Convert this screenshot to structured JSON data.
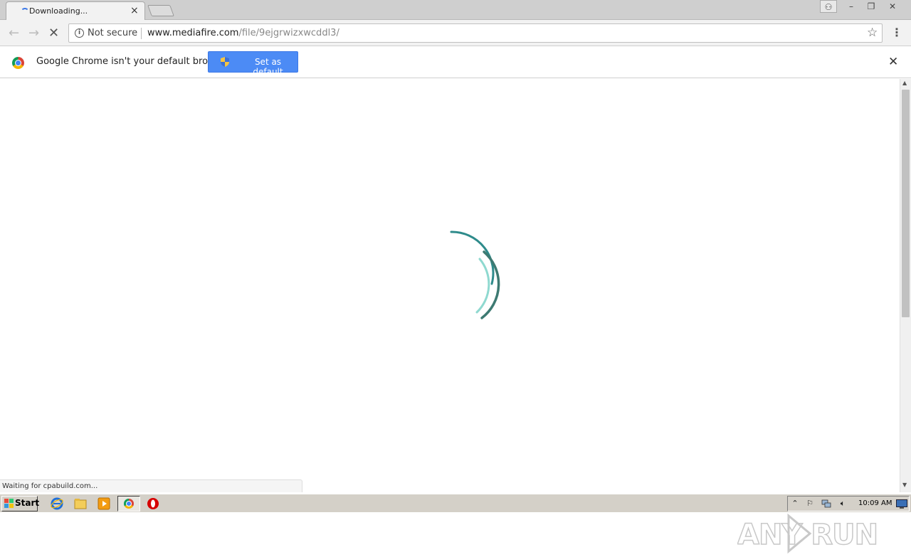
{
  "tab": {
    "title": "Downloading...",
    "close_glyph": "×"
  },
  "window_controls": {
    "profile": "⚇",
    "minimize": "–",
    "maximize": "❐",
    "close": "✕"
  },
  "toolbar": {
    "back_glyph": "←",
    "forward_glyph": "→",
    "stop_glyph": "✕",
    "security_label": "Not secure",
    "url_host": "www.mediafire.com",
    "url_path": "/file/9ejgrwizxwcddl3/",
    "star_glyph": "☆",
    "menu_glyph": "⋮"
  },
  "infobar": {
    "message": "Google Chrome isn't your default browser",
    "button_label": "Set as default",
    "close_glyph": "✕"
  },
  "status_text": "Waiting for cpabuild.com...",
  "watermark": {
    "text": "ANY RUN"
  },
  "taskbar": {
    "start_label": "Start",
    "clock": "10:09 AM"
  },
  "colors": {
    "spinner_dark": "#2e8b8b",
    "spinner_mid": "#3d7a72",
    "spinner_light": "#8fd9d0",
    "accent_button": "#4c8bf5"
  }
}
